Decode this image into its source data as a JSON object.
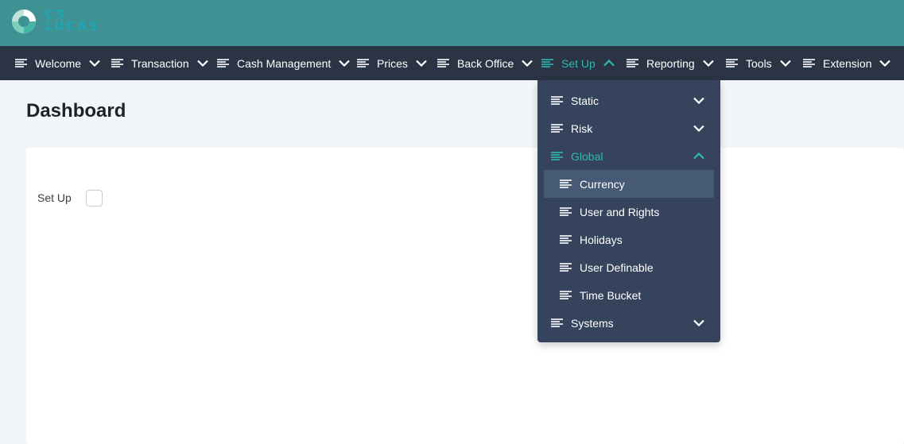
{
  "brand": {
    "logo_line1": "CS",
    "logo_line2": "LUCAS",
    "teal": "#3f9193",
    "accent": "#2eb8b2"
  },
  "navbar": {
    "items": [
      {
        "label": "Welcome",
        "icon": "menu-lines-icon",
        "chevron": "down"
      },
      {
        "label": "Transaction",
        "icon": "menu-lines-icon",
        "chevron": "down"
      },
      {
        "label": "Cash Management",
        "icon": "menu-lines-icon",
        "chevron": "down"
      },
      {
        "label": "Prices",
        "icon": "menu-lines-icon",
        "chevron": "down"
      },
      {
        "label": "Back Office",
        "icon": "menu-lines-icon",
        "chevron": "down"
      },
      {
        "label": "Set Up",
        "icon": "menu-lines-icon",
        "chevron": "up",
        "active": true
      },
      {
        "label": "Reporting",
        "icon": "menu-lines-icon",
        "chevron": "down"
      },
      {
        "label": "Tools",
        "icon": "menu-lines-icon",
        "chevron": "down"
      },
      {
        "label": "Extension",
        "icon": "menu-lines-icon",
        "chevron": "down"
      }
    ]
  },
  "dropdown": {
    "sections": [
      {
        "label": "Static",
        "chevron": "down"
      },
      {
        "label": "Risk",
        "chevron": "down"
      },
      {
        "label": "Global",
        "chevron": "up",
        "active": true,
        "children": [
          "Currency",
          "User and Rights",
          "Holidays",
          "User Definable",
          "Time Bucket"
        ],
        "highlighted_child": "Currency"
      },
      {
        "label": "Systems",
        "chevron": "down"
      }
    ]
  },
  "main": {
    "title": "Dashboard",
    "setup_label": "Set Up",
    "setup_checked": false
  }
}
